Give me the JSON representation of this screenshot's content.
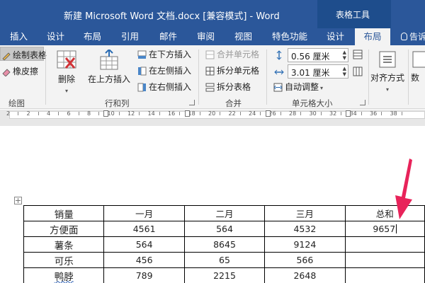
{
  "window": {
    "title": "新建 Microsoft Word 文档.docx [兼容模式] - Word",
    "context_tab": "表格工具"
  },
  "tabs": {
    "insert": "插入",
    "design": "设计",
    "layout": "布局",
    "references": "引用",
    "mailings": "邮件",
    "review": "审阅",
    "view": "视图",
    "features": "特色功能",
    "table_design": "设计",
    "table_layout": "布局",
    "tell_me": "告诉"
  },
  "ribbon": {
    "draw": {
      "draw_table": "绘制表格",
      "eraser": "橡皮擦",
      "label": "绘图"
    },
    "rows_cols": {
      "delete": "删除",
      "insert_above": "在上方插入",
      "insert_below": "在下方插入",
      "insert_left": "在左侧插入",
      "insert_right": "在右侧插入",
      "label": "行和列"
    },
    "merge": {
      "merge_cells": "合并单元格",
      "split_cells": "拆分单元格",
      "split_table": "拆分表格",
      "label": "合并"
    },
    "cell_size": {
      "height": "0.56 厘米",
      "width": "3.01 厘米",
      "autofit": "自动调整",
      "label": "单元格大小"
    },
    "alignment": {
      "label": "对齐方式"
    },
    "data": {
      "label": "数"
    }
  },
  "ruler": {
    "labels": [
      "2",
      "2",
      "4",
      "6",
      "8",
      "10",
      "12",
      "14",
      "16",
      "18",
      "20",
      "22",
      "24",
      "26",
      "28",
      "30",
      "32",
      "34",
      "36",
      "38"
    ]
  },
  "table": {
    "rows": [
      [
        "销量",
        "一月",
        "二月",
        "三月",
        "总和"
      ],
      [
        "方便面",
        "4561",
        "564",
        "4532",
        "9657"
      ],
      [
        "薯条",
        "564",
        "8645",
        "9124",
        ""
      ],
      [
        "可乐",
        "456",
        "65",
        "566",
        ""
      ],
      [
        "鸭脖",
        "789",
        "2215",
        "2648",
        ""
      ]
    ]
  },
  "colors": {
    "title_bar": "#2b579a",
    "context_tab": "#1e4d8c",
    "ribbon": "#f3f3f3",
    "arrow": "#e8235a"
  }
}
